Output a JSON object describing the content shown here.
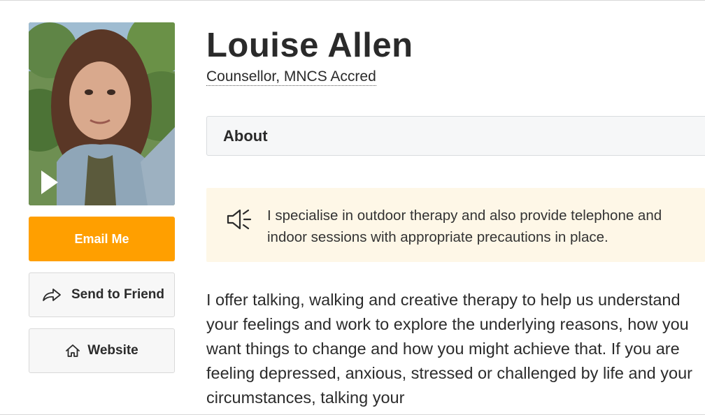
{
  "profile": {
    "name": "Louise Allen",
    "credentials": "Counsellor, MNCS Accred",
    "photo_icon": "profile-photo",
    "video_icon": "play-icon"
  },
  "actions": {
    "email_label": "Email Me",
    "send_label": "Send to Friend",
    "send_icon": "share-arrow-icon",
    "website_label": "Website",
    "website_icon": "home-icon",
    "accent_color": "#ff9f00"
  },
  "tabs": {
    "about_label": "About"
  },
  "notice": {
    "icon": "megaphone-icon",
    "text": "I specialise in outdoor therapy and also provide telephone and indoor sessions with appropriate precautions in place.",
    "background_color": "#fef7e7"
  },
  "bio": {
    "text": "I offer talking, walking and creative therapy to help us understand your feelings and work to explore the underlying reasons, how you want things to change and how you might achieve that. If you are feeling depressed, anxious, stressed or challenged by life and your circumstances, talking your"
  }
}
